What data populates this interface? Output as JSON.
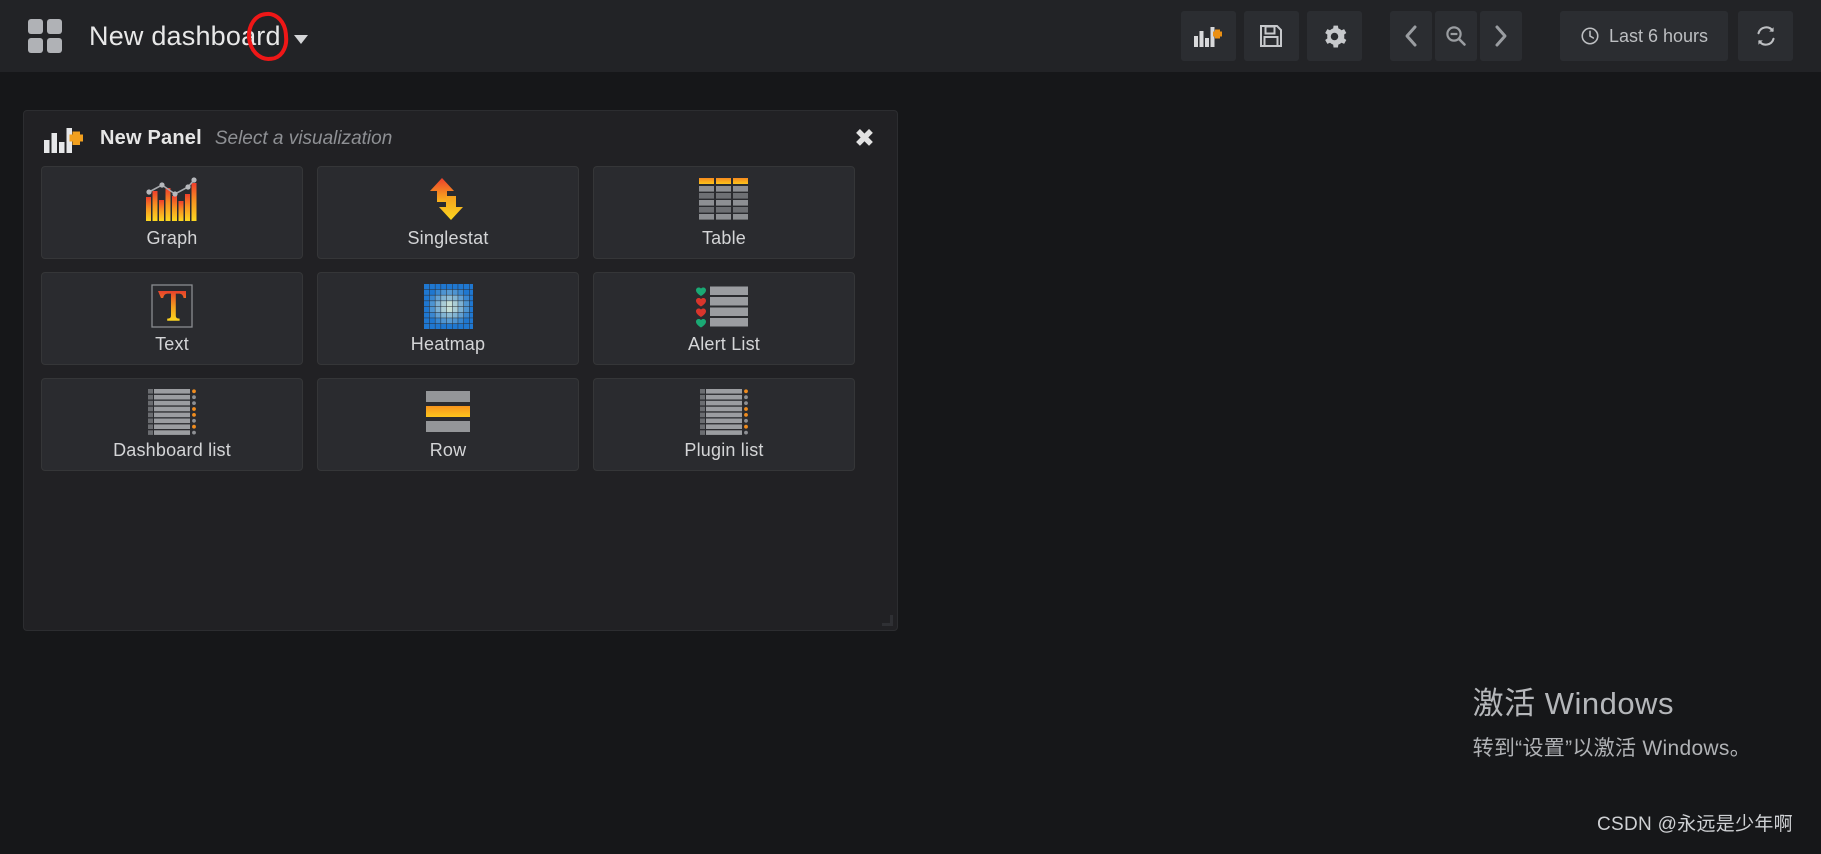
{
  "navbar": {
    "brand_icon": "dashboard-grid-icon",
    "dashboard_title": "New dashboard",
    "caret_icon": "chevron-down-icon",
    "buttons": [
      {
        "name": "add-panel-button",
        "icon": "bar-chart-plus-icon",
        "label": ""
      },
      {
        "name": "save-dashboard-button",
        "icon": "floppy-disk-save-icon",
        "label": ""
      },
      {
        "name": "dashboard-settings-button",
        "icon": "gear-icon",
        "label": ""
      },
      {
        "name": "time-back-button",
        "icon": "chevron-left-icon",
        "label": "‹"
      },
      {
        "name": "zoom-out-button",
        "icon": "magnifier-minus-icon",
        "label": ""
      },
      {
        "name": "time-forward-button",
        "icon": "chevron-right-icon",
        "label": "›"
      }
    ],
    "timepicker": {
      "icon": "clock-icon",
      "value": "Last 6 hours"
    },
    "refresh": {
      "icon": "refresh-icon",
      "label": ""
    }
  },
  "add_panel": {
    "icon": "bar-chart-plus-icon",
    "title": "New Panel",
    "subtitle": "Select a visualization",
    "close_icon": "close-icon",
    "close_label": "✖",
    "visualizations": [
      {
        "id": "graph",
        "label": "Graph",
        "icon": "graph-panel-icon"
      },
      {
        "id": "singlestat",
        "label": "Singlestat",
        "icon": "singlestat-panel-icon"
      },
      {
        "id": "table",
        "label": "Table",
        "icon": "table-panel-icon"
      },
      {
        "id": "text",
        "label": "Text",
        "icon": "text-panel-icon"
      },
      {
        "id": "heatmap",
        "label": "Heatmap",
        "icon": "heatmap-panel-icon"
      },
      {
        "id": "alertlist",
        "label": "Alert List",
        "icon": "alertlist-panel-icon"
      },
      {
        "id": "dashlist",
        "label": "Dashboard list",
        "icon": "dashlist-panel-icon"
      },
      {
        "id": "row",
        "label": "Row",
        "icon": "row-panel-icon"
      },
      {
        "id": "pluginlist",
        "label": "Plugin list",
        "icon": "pluginlist-panel-icon"
      }
    ]
  },
  "watermark": {
    "line1": "激活 Windows",
    "line2": "转到“设置”以激活 Windows。"
  },
  "credit": "CSDN @永远是少年啊",
  "colors": {
    "page_bg": "#161719",
    "navbar_bg": "#222326",
    "panel_bg": "#212124",
    "tile_bg": "#2a2b2f",
    "accent_orange": "#eb7b18",
    "accent_yellow": "#fccd1e",
    "accent_red": "#e24d42",
    "alert_ok_green": "#19a974",
    "heatmap_blue": "#1f77d0",
    "annotation_red": "#ef1717"
  }
}
